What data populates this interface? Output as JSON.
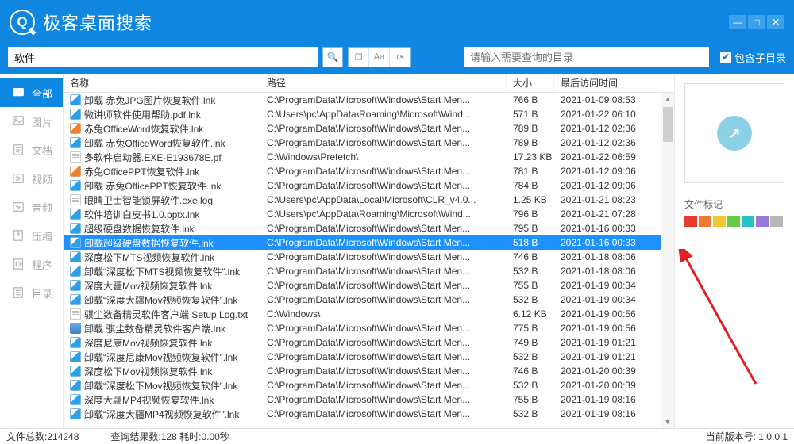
{
  "app": {
    "title": "极客桌面搜索"
  },
  "search": {
    "value": "软件",
    "path_placeholder": "请输入需要查询的目录",
    "include_sub": "包含子目录",
    "include_sub_checked": true
  },
  "sidebar": [
    {
      "label": "全部",
      "active": true
    },
    {
      "label": "图片",
      "active": false
    },
    {
      "label": "文档",
      "active": false
    },
    {
      "label": "视频",
      "active": false
    },
    {
      "label": "音频",
      "active": false
    },
    {
      "label": "压缩",
      "active": false
    },
    {
      "label": "程序",
      "active": false
    },
    {
      "label": "目录",
      "active": false
    }
  ],
  "columns": {
    "name": "名称",
    "path": "路径",
    "size": "大小",
    "date": "最后访问时间"
  },
  "rows": [
    {
      "icon": "lnk",
      "name": "卸载 赤兔JPG图片恢复软件.lnk",
      "path": "C:\\ProgramData\\Microsoft\\Windows\\Start Men...",
      "size": "766 B",
      "date": "2021-01-09 08:53"
    },
    {
      "icon": "lnk",
      "name": "微讲师软件使用帮助.pdf.lnk",
      "path": "C:\\Users\\pc\\AppData\\Roaming\\Microsoft\\Wind...",
      "size": "571 B",
      "date": "2021-01-22 06:10"
    },
    {
      "icon": "lnk-orange",
      "name": "赤兔OfficeWord恢复软件.lnk",
      "path": "C:\\ProgramData\\Microsoft\\Windows\\Start Men...",
      "size": "789 B",
      "date": "2021-01-12 02:36"
    },
    {
      "icon": "lnk",
      "name": "卸载 赤兔OfficeWord恢复软件.lnk",
      "path": "C:\\ProgramData\\Microsoft\\Windows\\Start Men...",
      "size": "789 B",
      "date": "2021-01-12 02:36"
    },
    {
      "icon": "doc",
      "name": "多软件启动器.EXE-E193678E.pf",
      "path": "C:\\Windows\\Prefetch\\",
      "size": "17.23 KB",
      "date": "2021-01-22 06:59"
    },
    {
      "icon": "lnk-orange",
      "name": "赤兔OfficePPT恢复软件.lnk",
      "path": "C:\\ProgramData\\Microsoft\\Windows\\Start Men...",
      "size": "781 B",
      "date": "2021-01-12 09:06"
    },
    {
      "icon": "lnk",
      "name": "卸载 赤兔OfficePPT恢复软件.lnk",
      "path": "C:\\ProgramData\\Microsoft\\Windows\\Start Men...",
      "size": "784 B",
      "date": "2021-01-12 09:06"
    },
    {
      "icon": "doc",
      "name": "眼睛卫士智能锁屏软件.exe.log",
      "path": "C:\\Users\\pc\\AppData\\Local\\Microsoft\\CLR_v4.0...",
      "size": "1.25 KB",
      "date": "2021-01-21 08:23"
    },
    {
      "icon": "lnk",
      "name": "软件培训白皮书1.0.pptx.lnk",
      "path": "C:\\Users\\pc\\AppData\\Roaming\\Microsoft\\Wind...",
      "size": "796 B",
      "date": "2021-01-21 07:28"
    },
    {
      "icon": "lnk",
      "name": "超级硬盘数据恢复软件.lnk",
      "path": "C:\\ProgramData\\Microsoft\\Windows\\Start Men...",
      "size": "795 B",
      "date": "2021-01-16 00:33"
    },
    {
      "icon": "lnk",
      "name": "卸载超级硬盘数据恢复软件.lnk",
      "path": "C:\\ProgramData\\Microsoft\\Windows\\Start Men...",
      "size": "518 B",
      "date": "2021-01-16 00:33",
      "selected": true
    },
    {
      "icon": "lnk",
      "name": "深度松下MTS视频恢复软件.lnk",
      "path": "C:\\ProgramData\\Microsoft\\Windows\\Start Men...",
      "size": "746 B",
      "date": "2021-01-18 08:06"
    },
    {
      "icon": "lnk",
      "name": "卸载“深度松下MTS视频恢复软件”.lnk",
      "path": "C:\\ProgramData\\Microsoft\\Windows\\Start Men...",
      "size": "532 B",
      "date": "2021-01-18 08:06"
    },
    {
      "icon": "lnk",
      "name": "深度大疆Mov视频恢复软件.lnk",
      "path": "C:\\ProgramData\\Microsoft\\Windows\\Start Men...",
      "size": "755 B",
      "date": "2021-01-19 00:34"
    },
    {
      "icon": "lnk",
      "name": "卸载“深度大疆Mov视频恢复软件”.lnk",
      "path": "C:\\ProgramData\\Microsoft\\Windows\\Start Men...",
      "size": "532 B",
      "date": "2021-01-19 00:34"
    },
    {
      "icon": "doc",
      "name": "骐尘数备精灵软件客户端 Setup Log.txt",
      "path": "C:\\Windows\\",
      "size": "6.12 KB",
      "date": "2021-01-19 00:56"
    },
    {
      "icon": "exe",
      "name": "卸载 骐尘数备精灵软件客户端.lnk",
      "path": "C:\\ProgramData\\Microsoft\\Windows\\Start Men...",
      "size": "775 B",
      "date": "2021-01-19 00:56"
    },
    {
      "icon": "lnk",
      "name": "深度尼康Mov视频恢复软件.lnk",
      "path": "C:\\ProgramData\\Microsoft\\Windows\\Start Men...",
      "size": "749 B",
      "date": "2021-01-19 01:21"
    },
    {
      "icon": "lnk",
      "name": "卸载“深度尼康Mov视频恢复软件”.lnk",
      "path": "C:\\ProgramData\\Microsoft\\Windows\\Start Men...",
      "size": "532 B",
      "date": "2021-01-19 01:21"
    },
    {
      "icon": "lnk",
      "name": "深度松下Mov视频恢复软件.lnk",
      "path": "C:\\ProgramData\\Microsoft\\Windows\\Start Men...",
      "size": "746 B",
      "date": "2021-01-20 00:39"
    },
    {
      "icon": "lnk",
      "name": "卸载“深度松下Mov视频恢复软件”.lnk",
      "path": "C:\\ProgramData\\Microsoft\\Windows\\Start Men...",
      "size": "532 B",
      "date": "2021-01-20 00:39"
    },
    {
      "icon": "lnk",
      "name": "深度大疆MP4视频恢复软件.lnk",
      "path": "C:\\ProgramData\\Microsoft\\Windows\\Start Men...",
      "size": "755 B",
      "date": "2021-01-19 08:16"
    },
    {
      "icon": "lnk",
      "name": "卸载“深度大疆MP4视频恢复软件”.lnk",
      "path": "C:\\ProgramData\\Microsoft\\Windows\\Start Men...",
      "size": "532 B",
      "date": "2021-01-19 08:16"
    }
  ],
  "preview": {
    "tags_label": "文件标记",
    "tag_colors": [
      "#e33b2e",
      "#f07830",
      "#f0c830",
      "#68c848",
      "#28c0c0",
      "#9878d8",
      "#b8b8b8"
    ]
  },
  "status": {
    "total_label": "文件总数:",
    "total": "214248",
    "results_label": "查询结果数:",
    "results": "128",
    "time_label": "耗时:",
    "time": "0.00秒",
    "version_label": "当前版本号:",
    "version": "1.0.0.1"
  }
}
